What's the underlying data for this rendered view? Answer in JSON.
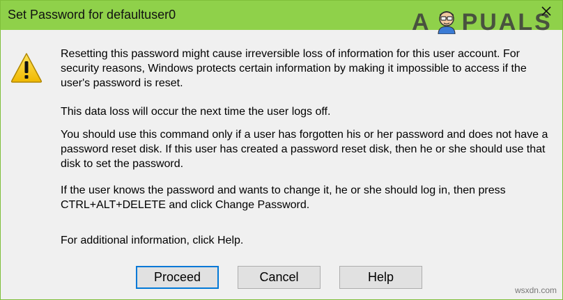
{
  "window": {
    "title": "Set Password for defaultuser0"
  },
  "icons": {
    "close": "close-icon",
    "warning": "warning-icon"
  },
  "logo": {
    "text_left": "A",
    "text_right": "PUALS"
  },
  "message": {
    "p1": "Resetting this password might cause irreversible loss of information for this user account. For security reasons, Windows protects certain information by making it impossible to access if the user's password is reset.",
    "p2": "This data loss will occur the next time the user logs off.",
    "p3": "You should use this command only if a user has forgotten his or her password and does not have a password reset disk. If this user has created a password reset disk, then he or she should use that disk to set the password.",
    "p4": "If the user knows the password and wants to change it, he or she should log in, then press CTRL+ALT+DELETE and click Change Password.",
    "p5": "For additional information, click Help."
  },
  "buttons": {
    "proceed": "Proceed",
    "cancel": "Cancel",
    "help": "Help"
  },
  "watermark": "wsxdn.com",
  "colors": {
    "titlebar": "#8fd14a",
    "focus_border": "#0078d7",
    "warning_yellow": "#f5c400"
  }
}
